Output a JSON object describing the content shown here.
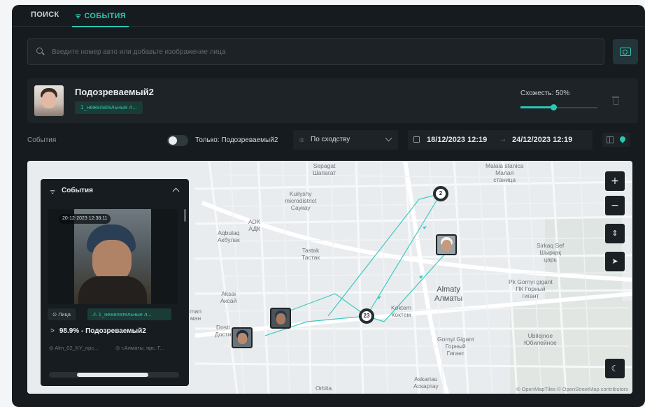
{
  "tabs": {
    "search": "ПОИСК",
    "events": "СОБЫТИЯ"
  },
  "search": {
    "placeholder": "Введите номер авто или добавьте изображение лица"
  },
  "suspect": {
    "name": "Подозреваемый2",
    "list_chip": "1_нежелательные л...",
    "similarity_label": "Схожесть: 50%",
    "similarity_value": 0.5
  },
  "filters": {
    "events_label": "События",
    "only_label": "Только: Подозреваемый2",
    "only_enabled": false,
    "sort_value": "По сходству",
    "date_from": "18/12/2023 12:19",
    "date_arrow": "→",
    "date_to": "24/12/2023 12:19"
  },
  "map": {
    "labels": {
      "sepagat": "Sepagat\nШапагат",
      "malaia": "Malaia stanica\nМалая\nстаница",
      "kulysh": "Kuilyshy\nmicrodistrict\nСаукау",
      "adk": "ADK\nАДК",
      "aqbulaq": "Aqbulaq\nАкбулак",
      "tastak": "Tastak\nТастак",
      "sirkaq": "Sirkaq Sef\nШырқақ\nцарь",
      "almaty": "Almaty\nАлматы",
      "pk_gorny": "Pk Gornyi gigant\nПК Горный\nгигант",
      "aksai": "Aksai\nАксай",
      "koktem": "Koktem\nКоктем",
      "dost": "Dosti\nДости",
      "nman": "rnan\nман",
      "gorny2": "Gornyi Gigant\nГорный\nГигант",
      "ubilejnoe": "Ubilejnoe\nЮбилейное",
      "askartau": "Askartau\nАскартау",
      "orbita": "Orbita"
    },
    "clusters": {
      "c1": "2",
      "c2": "23"
    },
    "attribution": "© OpenMapTiles © OpenStreetMap contributors",
    "controls": {
      "zoom_in": "+",
      "zoom_out": "−",
      "compass": "⇕",
      "locate": "➤",
      "theme": "☾"
    }
  },
  "panel": {
    "title": "События",
    "timestamp": "20-12-2023 12:38:11",
    "tag_face": "⊙ Лица",
    "tag_list": "⚠ 1_нежелательные л...",
    "match": "98.9% - Подозреваемый2",
    "camera": "◎ Alm_02_KY_npc...",
    "location": "◎ г.Алматы, прс. Г..."
  },
  "colors": {
    "accent": "#2cc7b3",
    "background": "#161b1f",
    "route": "#3ec9c0"
  }
}
